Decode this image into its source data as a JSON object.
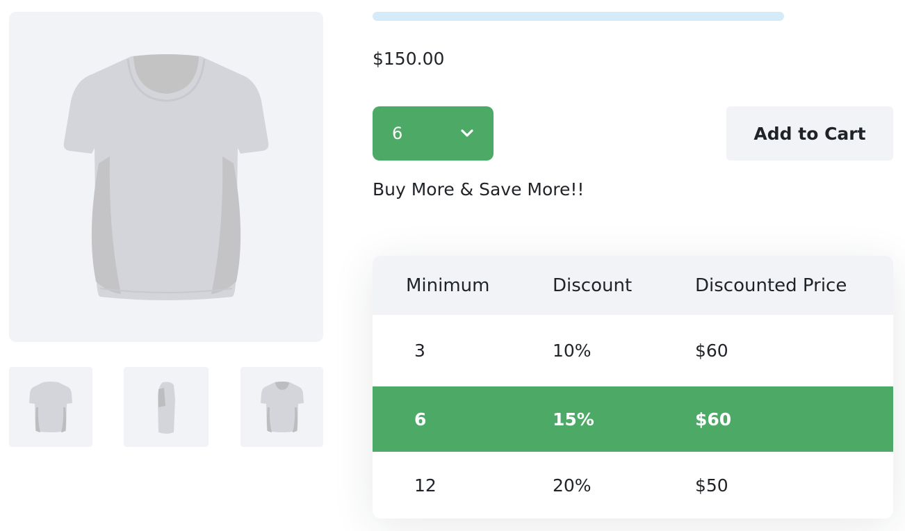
{
  "gallery": {
    "main_image_icon": "t-shirt-front-icon",
    "thumbnails": [
      {
        "icon": "t-shirt-back-icon"
      },
      {
        "icon": "t-shirt-side-icon"
      },
      {
        "icon": "t-shirt-front-icon"
      }
    ]
  },
  "product": {
    "price": "$150.00",
    "quantity_selected": "6",
    "add_to_cart_label": "Add to Cart",
    "promo_text": "Buy More & Save More!!"
  },
  "discount_table": {
    "headers": [
      "Minimum",
      "Discount",
      "Discounted Price"
    ],
    "rows": [
      {
        "minimum": "3",
        "discount": "10%",
        "price": "$60",
        "highlighted": false
      },
      {
        "minimum": "6",
        "discount": "15%",
        "price": "$60",
        "highlighted": true
      },
      {
        "minimum": "12",
        "discount": "20%",
        "price": "$50",
        "highlighted": false
      }
    ]
  },
  "colors": {
    "accent_green": "#4caa66",
    "panel_gray": "#f1f3f7",
    "progress_blue": "#d5ebfa",
    "text_dark": "#1f2328"
  }
}
